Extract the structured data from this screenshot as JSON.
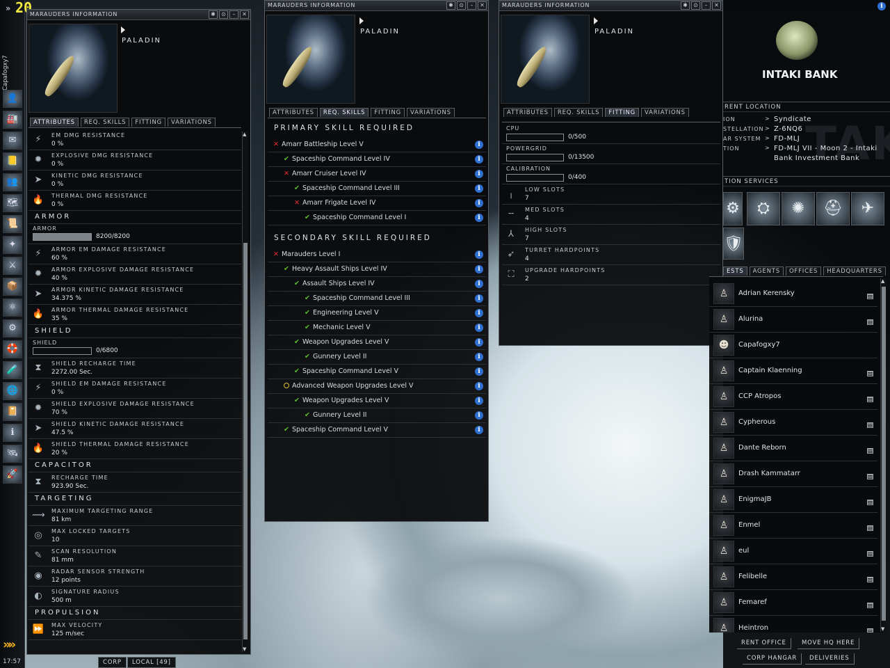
{
  "neocom": {
    "fps": "20",
    "clock": "17:57",
    "char_name": "Capafogxy7",
    "items": [
      "👤",
      "🏭",
      "✉",
      "📒",
      "👥",
      "🗺",
      "📜",
      "✦",
      "⚔",
      "📦",
      "⚛",
      "⚙",
      "🛟",
      "🧪",
      "🌐",
      "📔",
      "ℹ",
      "🛰",
      "🚀"
    ]
  },
  "win1": {
    "title": "Marauders Information",
    "ship": "PALADIN",
    "tabs": [
      "ATTRIBUTES",
      "REQ. SKILLS",
      "FITTING",
      "VARIATIONS"
    ],
    "top_attrs": [
      {
        "icon": "⚡",
        "k": "EM DMG RESISTANCE",
        "v": "0 %"
      },
      {
        "icon": "✹",
        "k": "EXPLOSIVE DMG RESISTANCE",
        "v": "0 %"
      },
      {
        "icon": "➤",
        "k": "KINETIC DMG RESISTANCE",
        "v": "0 %"
      },
      {
        "icon": "🔥",
        "k": "THERMAL DMG RESISTANCE",
        "v": "0 %"
      }
    ],
    "armor": {
      "title": "ARMOR",
      "label": "ARMOR",
      "value": "8200/8200",
      "fill": 1.0,
      "attrs": [
        {
          "icon": "⚡",
          "k": "ARMOR EM DAMAGE RESISTANCE",
          "v": "60 %"
        },
        {
          "icon": "✹",
          "k": "ARMOR EXPLOSIVE DAMAGE RESISTANCE",
          "v": "40 %"
        },
        {
          "icon": "➤",
          "k": "ARMOR KINETIC DAMAGE RESISTANCE",
          "v": "34.375 %"
        },
        {
          "icon": "🔥",
          "k": "ARMOR THERMAL DAMAGE RESISTANCE",
          "v": "35 %"
        }
      ]
    },
    "shield": {
      "title": "SHIELD",
      "label": "SHIELD",
      "value": "0/6800",
      "fill": 0,
      "attrs": [
        {
          "icon": "⧗",
          "k": "SHIELD RECHARGE TIME",
          "v": "2272.00 Sec."
        },
        {
          "icon": "⚡",
          "k": "SHIELD EM DAMAGE RESISTANCE",
          "v": "0 %"
        },
        {
          "icon": "✹",
          "k": "SHIELD EXPLOSIVE DAMAGE RESISTANCE",
          "v": "70 %"
        },
        {
          "icon": "➤",
          "k": "SHIELD KINETIC DAMAGE RESISTANCE",
          "v": "47.5 %"
        },
        {
          "icon": "🔥",
          "k": "SHIELD THERMAL DAMAGE RESISTANCE",
          "v": "20 %"
        }
      ]
    },
    "capacitor": {
      "title": "CAPACITOR",
      "attrs": [
        {
          "icon": "⧗",
          "k": "RECHARGE TIME",
          "v": "923.90 Sec."
        }
      ]
    },
    "targeting": {
      "title": "TARGETING",
      "attrs": [
        {
          "icon": "⟿",
          "k": "MAXIMUM TARGETING RANGE",
          "v": "81 km"
        },
        {
          "icon": "◎",
          "k": "MAX LOCKED TARGETS",
          "v": "10"
        },
        {
          "icon": "✎",
          "k": "SCAN RESOLUTION",
          "v": "81 mm"
        },
        {
          "icon": "◉",
          "k": "RADAR SENSOR STRENGTH",
          "v": "12 points"
        },
        {
          "icon": "◐",
          "k": "SIGNATURE RADIUS",
          "v": "500 m"
        }
      ]
    },
    "propulsion": {
      "title": "PROPULSION",
      "attrs": [
        {
          "icon": "⏩",
          "k": "MAX VELOCITY",
          "v": "125 m/sec"
        }
      ]
    }
  },
  "win2": {
    "title": "Marauders Information",
    "ship": "PALADIN",
    "tabs": [
      "ATTRIBUTES",
      "REQ. SKILLS",
      "FITTING",
      "VARIATIONS"
    ],
    "primary_title": "PRIMARY SKILL REQUIRED",
    "primary": [
      {
        "s": "x",
        "l": 0,
        "t": "Amarr Battleship Level V"
      },
      {
        "s": "c",
        "l": 1,
        "t": "Spaceship Command Level IV"
      },
      {
        "s": "x",
        "l": 1,
        "t": "Amarr Cruiser Level IV"
      },
      {
        "s": "c",
        "l": 2,
        "t": "Spaceship Command Level III"
      },
      {
        "s": "x",
        "l": 2,
        "t": "Amarr Frigate Level IV"
      },
      {
        "s": "c",
        "l": 3,
        "t": "Spaceship Command Level I"
      }
    ],
    "secondary_title": "SECONDARY SKILL REQUIRED",
    "secondary": [
      {
        "s": "x",
        "l": 0,
        "t": "Marauders Level I"
      },
      {
        "s": "c",
        "l": 1,
        "t": "Heavy Assault Ships Level IV"
      },
      {
        "s": "c",
        "l": 2,
        "t": "Assault Ships Level IV"
      },
      {
        "s": "c",
        "l": 3,
        "t": "Spaceship Command Level III"
      },
      {
        "s": "c",
        "l": 3,
        "t": "Engineering Level V"
      },
      {
        "s": "c",
        "l": 3,
        "t": "Mechanic Level V"
      },
      {
        "s": "c",
        "l": 2,
        "t": "Weapon Upgrades Level V"
      },
      {
        "s": "c",
        "l": 3,
        "t": "Gunnery Level II"
      },
      {
        "s": "c",
        "l": 2,
        "t": "Spaceship Command Level V"
      },
      {
        "s": "o",
        "l": 1,
        "t": "Advanced Weapon Upgrades Level V"
      },
      {
        "s": "c",
        "l": 2,
        "t": "Weapon Upgrades Level V"
      },
      {
        "s": "c",
        "l": 3,
        "t": "Gunnery Level II"
      },
      {
        "s": "c",
        "l": 1,
        "t": "Spaceship Command Level V"
      }
    ]
  },
  "win3": {
    "title": "Marauders Information",
    "ship": "PALADIN",
    "tabs": [
      "ATTRIBUTES",
      "REQ. SKILLS",
      "FITTING",
      "VARIATIONS"
    ],
    "cpu": {
      "label": "CPU",
      "value": "0/500"
    },
    "powergrid": {
      "label": "POWERGRID",
      "value": "0/13500"
    },
    "calibration": {
      "label": "CALIBRATION",
      "value": "0/400"
    },
    "slots": [
      {
        "icon": "╷",
        "k": "LOW SLOTS",
        "v": "7"
      },
      {
        "icon": "╌",
        "k": "MED SLOTS",
        "v": "4"
      },
      {
        "icon": "⅄",
        "k": "HIGH SLOTS",
        "v": "7"
      },
      {
        "icon": "➶",
        "k": "TURRET HARDPOINTS",
        "v": "4"
      },
      {
        "icon": "⛶",
        "k": "UPGRADE HARDPOINTS",
        "v": "2"
      }
    ]
  },
  "station": {
    "corp_name": "INTAKI BANK",
    "watermark": "TAK",
    "loc_header": "RENT LOCATION",
    "loc": [
      {
        "k": "ION",
        "v": "Syndicate"
      },
      {
        "k": "STELLATION",
        "v": "Z-6NQ6"
      },
      {
        "k": "AR SYSTEM",
        "v": "FD-MLJ"
      },
      {
        "k": "TION",
        "v": "FD-MLJ VII - Moon 2 - Intaki Bank Investment Bank"
      }
    ],
    "svc_header": "TION SERVICES",
    "services": [
      "⚙",
      "⛭",
      "✺",
      "⛑",
      "✈",
      "🛡"
    ],
    "tabs": [
      "ESTS",
      "AGENTS",
      "OFFICES",
      "HEADQUARTERS"
    ],
    "agents": [
      "Adrian Kerensky",
      "Alurina",
      "Capafogxy7",
      "Captain Klaenning",
      "CCP Atropos",
      "Cypherous",
      "Dante Reborn",
      "Drash Kammatarr",
      "EnigmaJB",
      "Enmel",
      "eul",
      "Felibelle",
      "Femaref",
      "Heintron"
    ],
    "buttons": [
      "RENT OFFICE",
      "MOVE HQ HERE",
      "CORP HANGAR",
      "DELIVERIES"
    ]
  },
  "chat": {
    "corp": "CORP",
    "local": "LOCAL [49]"
  }
}
